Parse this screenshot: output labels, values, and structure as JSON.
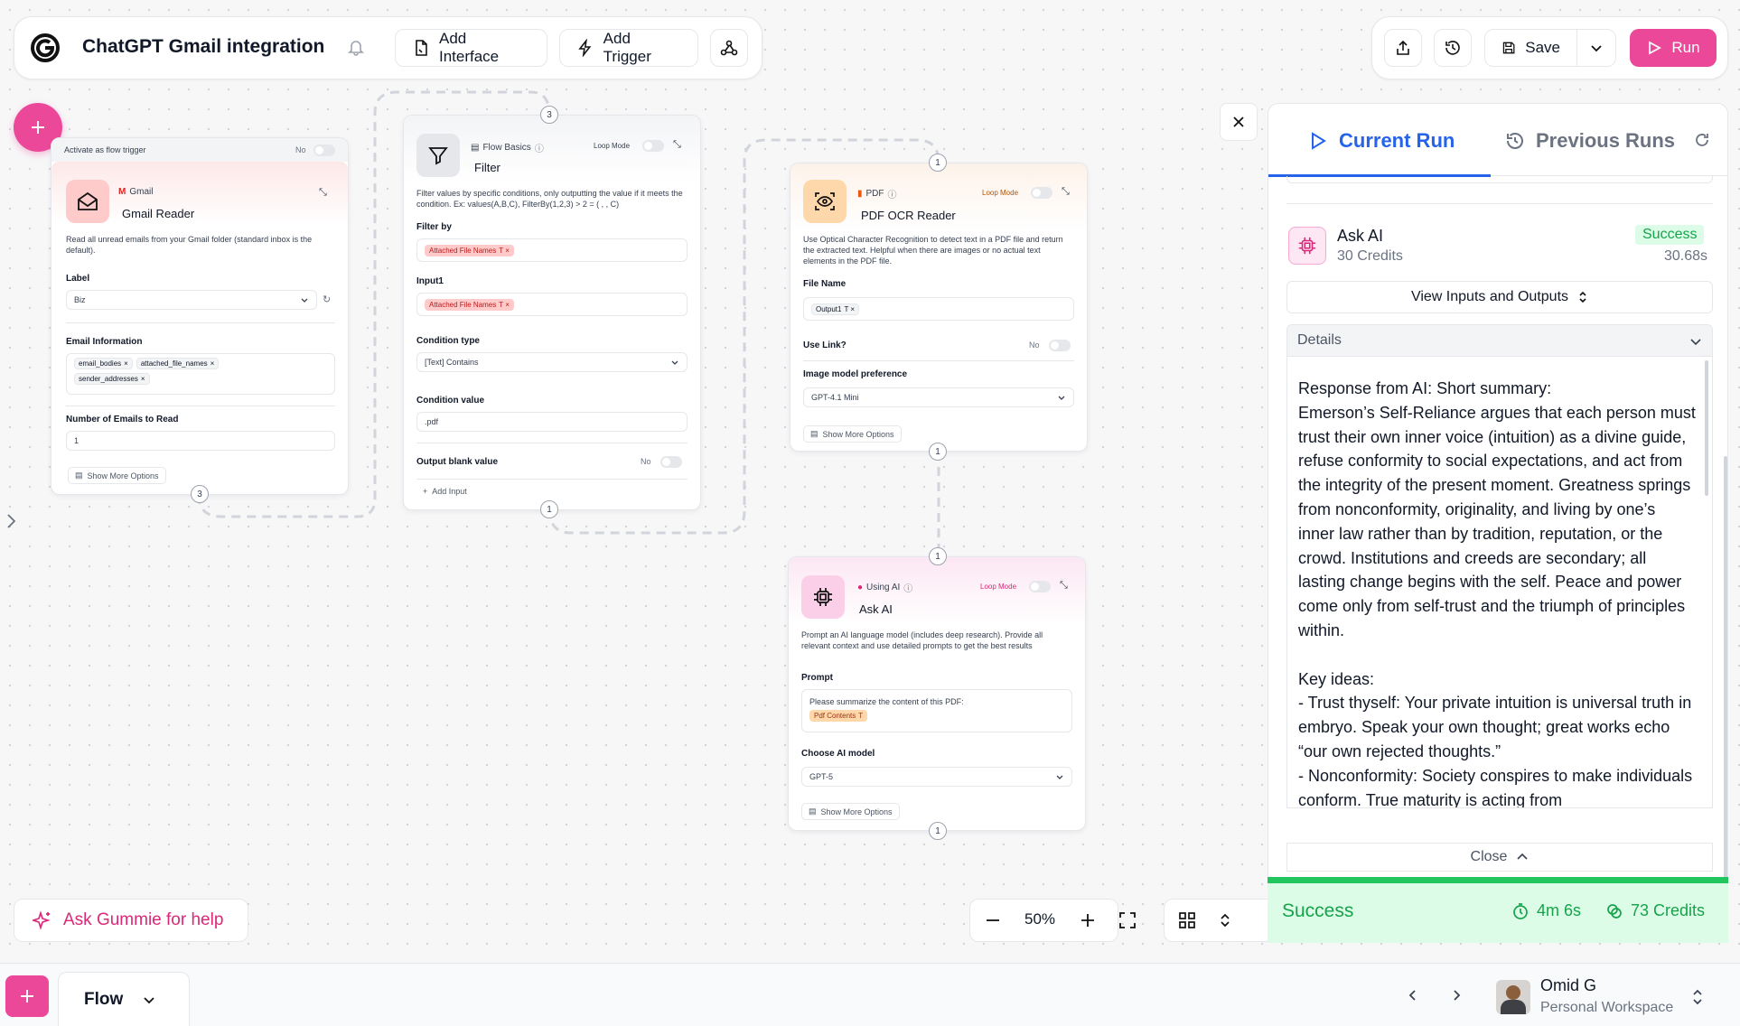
{
  "topbar": {
    "title": "ChatGPT Gmail integration",
    "add_interface": "Add Interface",
    "add_trigger": "Add Trigger",
    "save": "Save",
    "run": "Run"
  },
  "colors": {
    "accent": "#ec4899",
    "success": "#22c55e",
    "current_run": "#2563eb"
  },
  "nodes": {
    "gmail": {
      "trigger_label": "Activate as flow trigger",
      "trigger_value": "No",
      "category": "Gmail",
      "title": "Gmail Reader",
      "description": "Read all unread emails from your Gmail folder (standard inbox is the default).",
      "label_label": "Label",
      "label_value": "Biz",
      "email_info_label": "Email Information",
      "email_tags": [
        "email_bodies",
        "attached_file_names",
        "sender_addresses"
      ],
      "num_emails_label": "Number of Emails to Read",
      "num_emails_value": "1",
      "show_more": "Show More Options",
      "badge": "3"
    },
    "filter": {
      "category": "Flow Basics",
      "loop_mode": "Loop Mode",
      "title": "Filter",
      "description": "Filter values by specific conditions, only outputting the value if it meets the condition. Ex: values(A,B,C), FilterBy(1,2,3) > 2 = ( , , C)",
      "filter_by_label": "Filter by",
      "filter_by_tag": "Attached File Names",
      "input1_label": "Input1",
      "input1_tag": "Attached File Names",
      "condition_type_label": "Condition type",
      "condition_type_value": "[Text] Contains",
      "condition_value_label": "Condition value",
      "condition_value": ".pdf",
      "output_blank_label": "Output blank value",
      "output_blank_value": "No",
      "add_input": "Add Input",
      "badge_top": "3",
      "badge_bottom": "1"
    },
    "pdf": {
      "category": "PDF",
      "loop_mode": "Loop Mode",
      "title": "PDF OCR Reader",
      "description": "Use Optical Character Recognition to detect text in a PDF file and return the extracted text. Helpful when there are images or no actual text elements in the PDF file.",
      "file_name_label": "File Name",
      "file_name_tag": "Output1",
      "use_link_label": "Use Link?",
      "use_link_value": "No",
      "image_model_label": "Image model preference",
      "image_model_value": "GPT-4.1 Mini",
      "show_more": "Show More Options",
      "badge_top": "1",
      "badge_bottom": "1"
    },
    "askai": {
      "category": "Using AI",
      "loop_mode": "Loop Mode",
      "title": "Ask AI",
      "description": "Prompt an AI language model (includes deep research). Provide all relevant context and use detailed prompts to get the best results",
      "prompt_label": "Prompt",
      "prompt_text": "Please summarize the content of this PDF:",
      "prompt_tag": "Pdf Contents",
      "model_label": "Choose AI model",
      "model_value": "GPT-5",
      "show_more": "Show More Options",
      "badge_top": "1",
      "badge_bottom": "1"
    }
  },
  "panel": {
    "tab_current": "Current Run",
    "tab_previous": "Previous Runs",
    "item_title": "Ask AI",
    "item_credits": "30 Credits",
    "item_status": "Success",
    "item_time": "30.68s",
    "view_io": "View Inputs and Outputs",
    "details": "Details",
    "response": "Response from AI: Short summary:\nEmerson’s Self-Reliance argues that each person must trust their own inner voice (intuition) as a divine guide, refuse conformity to social expectations, and act from the integrity of the present moment. Greatness springs from nonconformity, originality, and living by one’s inner law rather than by tradition, reputation, or the crowd. Institutions and creeds are secondary; all lasting change begins with the self. Peace and power come only from self-trust and the triumph of principles within.\n\nKey ideas:\n- Trust thyself: Your private intuition is universal truth in embryo. Speak your own thought; great works echo “our own rejected thoughts.”\n- Nonconformity: Society conspires to make individuals conform. True maturity is acting from",
    "close": "Close",
    "footer_status": "Success",
    "footer_time": "4m 6s",
    "footer_credits": "73 Credits"
  },
  "bottom": {
    "ask_gummie": "Ask Gummie for help",
    "zoom": "50%",
    "flow_tab": "Flow",
    "user_name": "Omid G",
    "workspace": "Personal Workspace"
  }
}
